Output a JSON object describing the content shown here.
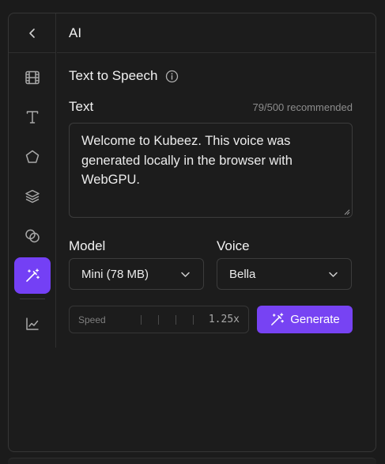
{
  "header": {
    "title": "AI"
  },
  "sidebar": {
    "items": [
      {
        "icon": "film-icon"
      },
      {
        "icon": "text-icon"
      },
      {
        "icon": "pentagon-icon"
      },
      {
        "icon": "layers-icon"
      },
      {
        "icon": "circles-icon"
      },
      {
        "icon": "magic-wand-icon",
        "active": true
      },
      {
        "icon": "chart-icon"
      }
    ]
  },
  "tts": {
    "title": "Text to Speech",
    "text_label": "Text",
    "counter": "79/500 recommended",
    "text_value": "Welcome to Kubeez. This voice was generated locally in the browser with WebGPU.",
    "model_label": "Model",
    "model_value": "Mini (78 MB)",
    "voice_label": "Voice",
    "voice_value": "Bella",
    "speed_label": "Speed",
    "speed_value": "1.25x",
    "generate_label": "Generate"
  },
  "colors": {
    "accent": "#7743f3",
    "background": "#1c1c1c",
    "border": "#3c3c3c"
  }
}
